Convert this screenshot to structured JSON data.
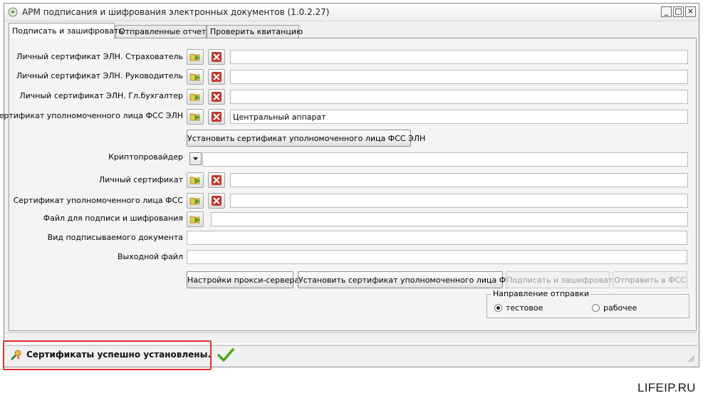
{
  "window": {
    "title": "АРМ подписания и шифрования электронных документов (1.0.2.27)",
    "controls": {
      "minimize": "_",
      "maximize": "□",
      "close": "×"
    }
  },
  "tabs": [
    {
      "label": "Подписать и зашифровать",
      "active": true
    },
    {
      "label": "Отправленные отчеты",
      "active": false
    },
    {
      "label": "Проверить квитанцию",
      "active": false
    }
  ],
  "form": {
    "cert_insurer": {
      "label": "Личный сертификат ЭЛН. Страхователь",
      "value": ""
    },
    "cert_head": {
      "label": "Личный сертификат ЭЛН. Руководитель",
      "value": ""
    },
    "cert_accountant": {
      "label": "Личный сертификат ЭЛН. Гл.бухгалтер",
      "value": ""
    },
    "cert_fss_eln": {
      "label": "Сертификат уполномоченного лица ФСС ЭЛН",
      "value": "Центральный аппарат"
    },
    "install_fss_eln_button": "Установить сертификат уполномоченного лица ФСС ЭЛН",
    "crypto_provider": {
      "label": "Криптопровайдер",
      "value": ""
    },
    "personal_cert": {
      "label": "Личный сертификат",
      "value": ""
    },
    "cert_fss": {
      "label": "Сертификат уполномоченного лица ФСС",
      "value": ""
    },
    "file": {
      "label": "Файл для подписи и шифрования",
      "value": ""
    },
    "doc_type": {
      "label": "Вид подписываемого документа",
      "value": ""
    },
    "output_file": {
      "label": "Выходной файл",
      "value": ""
    }
  },
  "actions": {
    "proxy": "Настройки прокси-сервера",
    "install_fss": "Установить сертификат уполномоченного лица ФСС",
    "sign_encrypt": "Подписать и зашифровать",
    "send_fss": "Отправить в ФСС"
  },
  "direction": {
    "title": "Направление отправки",
    "options": [
      {
        "label": "тестовое",
        "selected": true
      },
      {
        "label": "рабочее",
        "selected": false
      }
    ]
  },
  "status": {
    "message": "Сертификаты успешно установлены."
  },
  "watermark": "LIFEIP.RU",
  "colors": {
    "highlight": "#e03131",
    "accent_green": "#4caf2e",
    "delete_red": "#c0392b"
  },
  "icons": {
    "pick": "folder-certificate-icon",
    "clear": "delete-x-icon",
    "success": "checkmark-icon"
  }
}
